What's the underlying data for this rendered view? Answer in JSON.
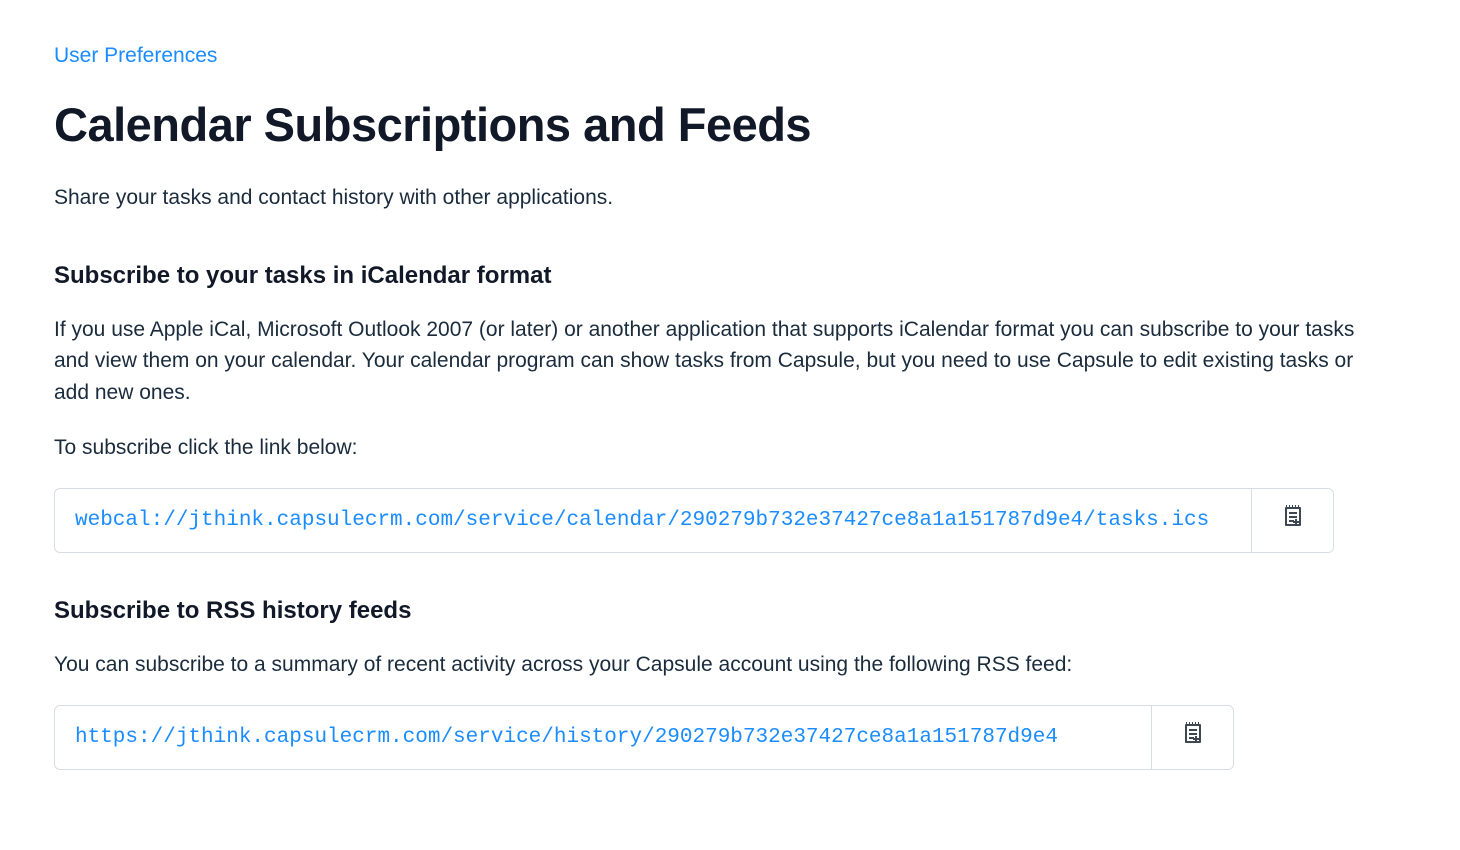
{
  "breadcrumb": {
    "label": "User Preferences"
  },
  "page": {
    "title": "Calendar Subscriptions and Feeds",
    "intro": "Share your tasks and contact history with other applications."
  },
  "sections": {
    "ical": {
      "heading": "Subscribe to your tasks in iCalendar format",
      "description": "If you use Apple iCal, Microsoft Outlook 2007 (or later) or another application that supports iCalendar format you can subscribe to your tasks and view them on your calendar. Your calendar program can show tasks from Capsule, but you need to use Capsule to edit existing tasks or add new ones.",
      "instruction": "To subscribe click the link below:",
      "url": "webcal://jthink.capsulecrm.com/service/calendar/290279b732e37427ce8a1a151787d9e4/tasks.ics"
    },
    "rss": {
      "heading": "Subscribe to RSS history feeds",
      "description": "You can subscribe to a summary of recent activity across your Capsule account using the following RSS feed:",
      "url": "https://jthink.capsulecrm.com/service/history/290279b732e37427ce8a1a151787d9e4"
    }
  }
}
